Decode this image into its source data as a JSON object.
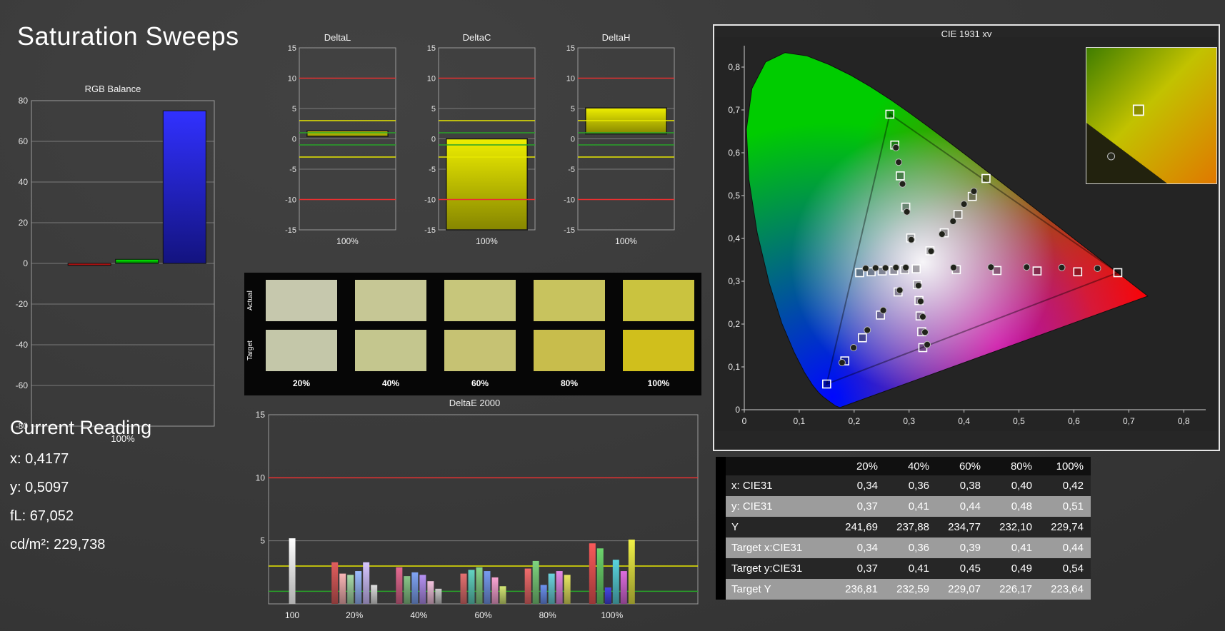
{
  "page": {
    "title": "Saturation Sweeps",
    "background": "#3a3a3a"
  },
  "current_reading": {
    "title": "Current Reading",
    "lines": [
      "x: 0,4177",
      "y: 0,5097",
      "fL: 67,052",
      "cd/m²: 229,738"
    ]
  },
  "swatch_panel": {
    "row_labels": [
      "Actual",
      "Target"
    ],
    "column_labels": [
      "20%",
      "40%",
      "60%",
      "80%",
      "100%"
    ],
    "actual_colors": [
      "#c6c8ad",
      "#c6c795",
      "#c7c67b",
      "#c8c35e",
      "#cac33f"
    ],
    "target_colors": [
      "#c4c7a9",
      "#c4c68e",
      "#c6c273",
      "#c8bd4c",
      "#d0bf1c"
    ]
  },
  "measurement_table": {
    "columns": [
      "20%",
      "40%",
      "60%",
      "80%",
      "100%"
    ],
    "rows": [
      {
        "label": "x: CIE31",
        "values": [
          "0,34",
          "0,36",
          "0,38",
          "0,40",
          "0,42"
        ]
      },
      {
        "label": "y: CIE31",
        "values": [
          "0,37",
          "0,41",
          "0,44",
          "0,48",
          "0,51"
        ]
      },
      {
        "label": "Y",
        "values": [
          "241,69",
          "237,88",
          "234,77",
          "232,10",
          "229,74"
        ]
      },
      {
        "label": "Target x:CIE31",
        "values": [
          "0,34",
          "0,36",
          "0,39",
          "0,41",
          "0,44"
        ]
      },
      {
        "label": "Target y:CIE31",
        "values": [
          "0,37",
          "0,41",
          "0,45",
          "0,49",
          "0,54"
        ]
      },
      {
        "label": "Target Y",
        "values": [
          "236,81",
          "232,59",
          "229,07",
          "226,17",
          "223,64"
        ]
      }
    ]
  },
  "chart_data": [
    {
      "id": "rgb_balance",
      "type": "bar",
      "title": "RGB Balance",
      "xlabel": "100%",
      "ylim": [
        -80,
        80
      ],
      "yticks": [
        80,
        60,
        40,
        20,
        0,
        -20,
        -40,
        -60,
        -80
      ],
      "categories": [
        "Red",
        "Green",
        "Blue"
      ],
      "values": [
        -1,
        2,
        75
      ],
      "colors": [
        "#b01010",
        "#00b400",
        "#2222e6"
      ]
    },
    {
      "id": "delta_l",
      "type": "bar",
      "title": "DeltaL",
      "xlabel": "100%",
      "ylim": [
        -15,
        15
      ],
      "yticks": [
        15,
        10,
        5,
        0,
        -5,
        -10,
        -15
      ],
      "reference_lines": [
        {
          "y": 10,
          "color": "#e83030"
        },
        {
          "y": 3,
          "color": "#e8e800"
        },
        {
          "y": 1,
          "color": "#28a428"
        },
        {
          "y": -1,
          "color": "#28a428"
        },
        {
          "y": -3,
          "color": "#e8e800"
        },
        {
          "y": -10,
          "color": "#e83030"
        }
      ],
      "bar": {
        "from": 0.4,
        "to": 1.3,
        "color": "#d8d800"
      }
    },
    {
      "id": "delta_c",
      "type": "bar",
      "title": "DeltaC",
      "xlabel": "100%",
      "ylim": [
        -15,
        15
      ],
      "yticks": [
        15,
        10,
        5,
        0,
        -5,
        -10,
        -15
      ],
      "reference_lines": [
        {
          "y": 10,
          "color": "#e83030"
        },
        {
          "y": 3,
          "color": "#e8e800"
        },
        {
          "y": 1,
          "color": "#28a428"
        },
        {
          "y": -1,
          "color": "#28a428"
        },
        {
          "y": -3,
          "color": "#e8e800"
        },
        {
          "y": -10,
          "color": "#e83030"
        }
      ],
      "bar": {
        "from": 0,
        "to": -15,
        "color": "#d8d800"
      }
    },
    {
      "id": "delta_h",
      "type": "bar",
      "title": "DeltaH",
      "xlabel": "100%",
      "ylim": [
        -15,
        15
      ],
      "yticks": [
        15,
        10,
        5,
        0,
        -5,
        -10,
        -15
      ],
      "reference_lines": [
        {
          "y": 10,
          "color": "#e83030"
        },
        {
          "y": 3,
          "color": "#e8e800"
        },
        {
          "y": 1,
          "color": "#28a428"
        },
        {
          "y": -1,
          "color": "#28a428"
        },
        {
          "y": -3,
          "color": "#e8e800"
        },
        {
          "y": -10,
          "color": "#e83030"
        }
      ],
      "bar": {
        "from": 0.8,
        "to": 5.1,
        "color": "#d8d800"
      }
    },
    {
      "id": "delta_e2000",
      "type": "bar",
      "title": "DeltaE 2000",
      "ylim": [
        0,
        15
      ],
      "yticks": [
        15,
        10,
        5
      ],
      "reference_lines": [
        {
          "y": 10,
          "color": "#e83030"
        },
        {
          "y": 3,
          "color": "#e8e800"
        },
        {
          "y": 1,
          "color": "#28a428"
        }
      ],
      "groups": [
        {
          "label": "100",
          "bars": [
            {
              "color": "#f2f2f2",
              "value": 5.2
            }
          ]
        },
        {
          "label": "20%",
          "bars": [
            {
              "color": "#c05050",
              "value": 3.3
            },
            {
              "color": "#d49a9a",
              "value": 2.4
            },
            {
              "color": "#8fba8f",
              "value": 2.3
            },
            {
              "color": "#86a0dc",
              "value": 2.6
            },
            {
              "color": "#b7a9e3",
              "value": 3.3
            },
            {
              "color": "#bdbdbd",
              "value": 1.5
            }
          ]
        },
        {
          "label": "40%",
          "bars": [
            {
              "color": "#c25a7c",
              "value": 2.9
            },
            {
              "color": "#74a874",
              "value": 2.2
            },
            {
              "color": "#6d8cd0",
              "value": 2.5
            },
            {
              "color": "#9a7cce",
              "value": 2.3
            },
            {
              "color": "#cfa6bd",
              "value": 1.8
            },
            {
              "color": "#ababab",
              "value": 1.2
            }
          ]
        },
        {
          "label": "60%",
          "bars": [
            {
              "color": "#c26060",
              "value": 2.4
            },
            {
              "color": "#54b4a4",
              "value": 2.7
            },
            {
              "color": "#74b474",
              "value": 2.9
            },
            {
              "color": "#6684cc",
              "value": 2.6
            },
            {
              "color": "#d48cb4",
              "value": 2.1
            },
            {
              "color": "#b4c464",
              "value": 1.4
            }
          ]
        },
        {
          "label": "80%",
          "bars": [
            {
              "color": "#cc5c5c",
              "value": 2.8
            },
            {
              "color": "#6cb46c",
              "value": 3.4
            },
            {
              "color": "#5c7ccc",
              "value": 1.5
            },
            {
              "color": "#5cb4bc",
              "value": 2.4
            },
            {
              "color": "#c474c4",
              "value": 2.6
            },
            {
              "color": "#c4c454",
              "value": 2.3
            }
          ]
        },
        {
          "label": "100%",
          "bars": [
            {
              "color": "#d44c4c",
              "value": 4.8
            },
            {
              "color": "#5cb45c",
              "value": 4.4
            },
            {
              "color": "#3c3cc4",
              "value": 1.3
            },
            {
              "color": "#4cb4bc",
              "value": 3.5
            },
            {
              "color": "#bc5cbc",
              "value": 2.6
            },
            {
              "color": "#cccc3c",
              "value": 5.1
            }
          ]
        }
      ]
    },
    {
      "id": "cie1931",
      "type": "scatter",
      "title": "CIE 1931 xy",
      "xlim": [
        0,
        0.84
      ],
      "ylim": [
        0,
        0.85
      ],
      "tick_values": [
        0,
        0.1,
        0.2,
        0.3,
        0.4,
        0.5,
        0.6,
        0.7,
        0.8
      ],
      "xtick_labels": [
        "0",
        "0,1",
        "0,2",
        "0,3",
        "0,4",
        "0,5",
        "0,6",
        "0,7",
        "0,8"
      ],
      "ytick_labels": [
        "0",
        "0,1",
        "0,2",
        "0,3",
        "0,4",
        "0,5",
        "0,6",
        "0,7",
        "0,8"
      ],
      "series": [
        {
          "name": "targets",
          "marker": "square",
          "points": [
            [
              0.313,
              0.329
            ],
            [
              0.386,
              0.327
            ],
            [
              0.46,
              0.325
            ],
            [
              0.533,
              0.324
            ],
            [
              0.607,
              0.322
            ],
            [
              0.68,
              0.32
            ],
            [
              0.303,
              0.401
            ],
            [
              0.294,
              0.473
            ],
            [
              0.284,
              0.546
            ],
            [
              0.274,
              0.618
            ],
            [
              0.265,
              0.69
            ],
            [
              0.28,
              0.275
            ],
            [
              0.248,
              0.221
            ],
            [
              0.215,
              0.168
            ],
            [
              0.183,
              0.114
            ],
            [
              0.15,
              0.06
            ],
            [
              0.292,
              0.327
            ],
            [
              0.272,
              0.325
            ],
            [
              0.251,
              0.324
            ],
            [
              0.231,
              0.322
            ],
            [
              0.21,
              0.32
            ],
            [
              0.315,
              0.292
            ],
            [
              0.318,
              0.255
            ],
            [
              0.32,
              0.219
            ],
            [
              0.323,
              0.182
            ],
            [
              0.325,
              0.145
            ],
            [
              0.338,
              0.371
            ],
            [
              0.364,
              0.413
            ],
            [
              0.389,
              0.456
            ],
            [
              0.415,
              0.498
            ],
            [
              0.44,
              0.54
            ]
          ]
        },
        {
          "name": "measured",
          "marker": "circle",
          "points": [
            [
              0.381,
              0.332
            ],
            [
              0.449,
              0.333
            ],
            [
              0.514,
              0.333
            ],
            [
              0.578,
              0.332
            ],
            [
              0.643,
              0.33
            ],
            [
              0.304,
              0.397
            ],
            [
              0.296,
              0.462
            ],
            [
              0.288,
              0.527
            ],
            [
              0.281,
              0.578
            ],
            [
              0.276,
              0.612
            ],
            [
              0.283,
              0.279
            ],
            [
              0.253,
              0.232
            ],
            [
              0.224,
              0.186
            ],
            [
              0.199,
              0.145
            ],
            [
              0.178,
              0.11
            ],
            [
              0.294,
              0.332
            ],
            [
              0.276,
              0.332
            ],
            [
              0.257,
              0.331
            ],
            [
              0.239,
              0.331
            ],
            [
              0.221,
              0.33
            ],
            [
              0.317,
              0.29
            ],
            [
              0.321,
              0.253
            ],
            [
              0.325,
              0.217
            ],
            [
              0.329,
              0.181
            ],
            [
              0.333,
              0.152
            ],
            [
              0.34,
              0.37
            ],
            [
              0.36,
              0.41
            ],
            [
              0.38,
              0.44
            ],
            [
              0.4,
              0.48
            ],
            [
              0.418,
              0.51
            ]
          ]
        }
      ],
      "inset": {
        "squares": [
          [
            0.4,
            0.46
          ]
        ],
        "dots": [
          [
            0.19,
            0.8
          ]
        ]
      }
    }
  ]
}
